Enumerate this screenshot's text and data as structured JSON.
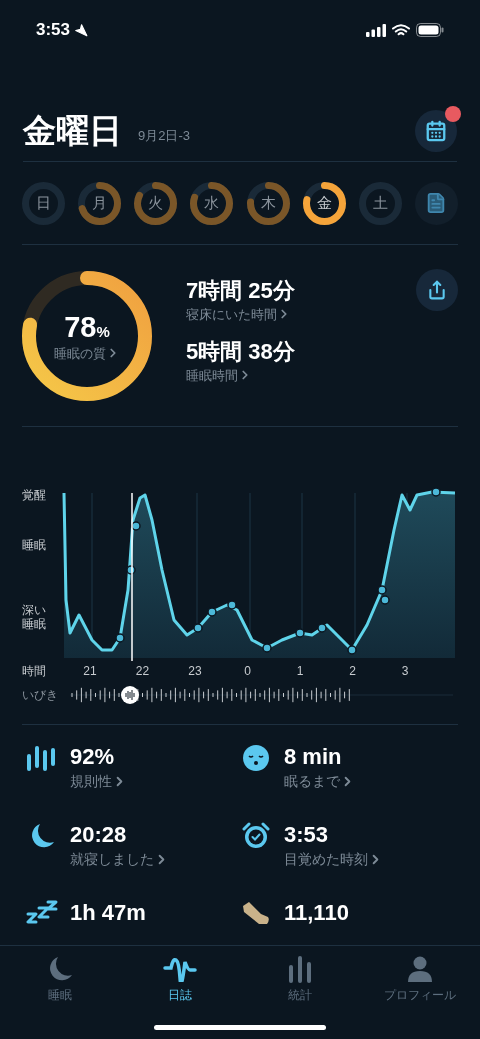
{
  "status_bar": {
    "time": "3:53"
  },
  "header": {
    "title": "金曜日",
    "subtitle": "9月2日-3",
    "calendar_badge": true
  },
  "days": [
    {
      "label": "日",
      "selected": false
    },
    {
      "label": "月",
      "level": 0.7,
      "selected": false
    },
    {
      "label": "火",
      "level": 0.82,
      "selected": false
    },
    {
      "label": "水",
      "level": 0.8,
      "selected": false
    },
    {
      "label": "木",
      "level": 0.76,
      "selected": false
    },
    {
      "label": "金",
      "level": 0.78,
      "selected": true
    },
    {
      "label": "土",
      "selected": false
    }
  ],
  "summary": {
    "quality": {
      "value": "78",
      "unit": "%",
      "label": "睡眠の質",
      "level": 0.78
    },
    "stats": [
      {
        "value": "7時間 25分",
        "label": "寝床にいた時間"
      },
      {
        "value": "5時間 38分",
        "label": "睡眠時間"
      }
    ]
  },
  "chart": {
    "y_labels": [
      "覚醒",
      "睡眠",
      "深い睡眠"
    ],
    "x_label": "時間",
    "x_ticks": [
      "21",
      "22",
      "23",
      "0",
      "1",
      "2",
      "3"
    ],
    "snore_label": "いびき"
  },
  "metrics": [
    {
      "kind": "regularity",
      "value": "92%",
      "label": "規則性"
    },
    {
      "kind": "fall-asleep",
      "value": "8 min",
      "label": "眠るまで"
    },
    {
      "kind": "bedtime",
      "value": "20:28",
      "label": "就寝しました"
    },
    {
      "kind": "wake",
      "value": "3:53",
      "label": "目覚めた時刻"
    },
    {
      "kind": "snore",
      "value": "1h 47m"
    },
    {
      "kind": "steps",
      "value": "11,110"
    }
  ],
  "tabs": [
    {
      "kind": "sleep",
      "label": "睡眠",
      "selected": false
    },
    {
      "kind": "journal",
      "label": "日誌",
      "selected": true
    },
    {
      "kind": "stats",
      "label": "統計",
      "selected": false
    },
    {
      "kind": "profile",
      "label": "プロフィール",
      "selected": false
    }
  ]
}
